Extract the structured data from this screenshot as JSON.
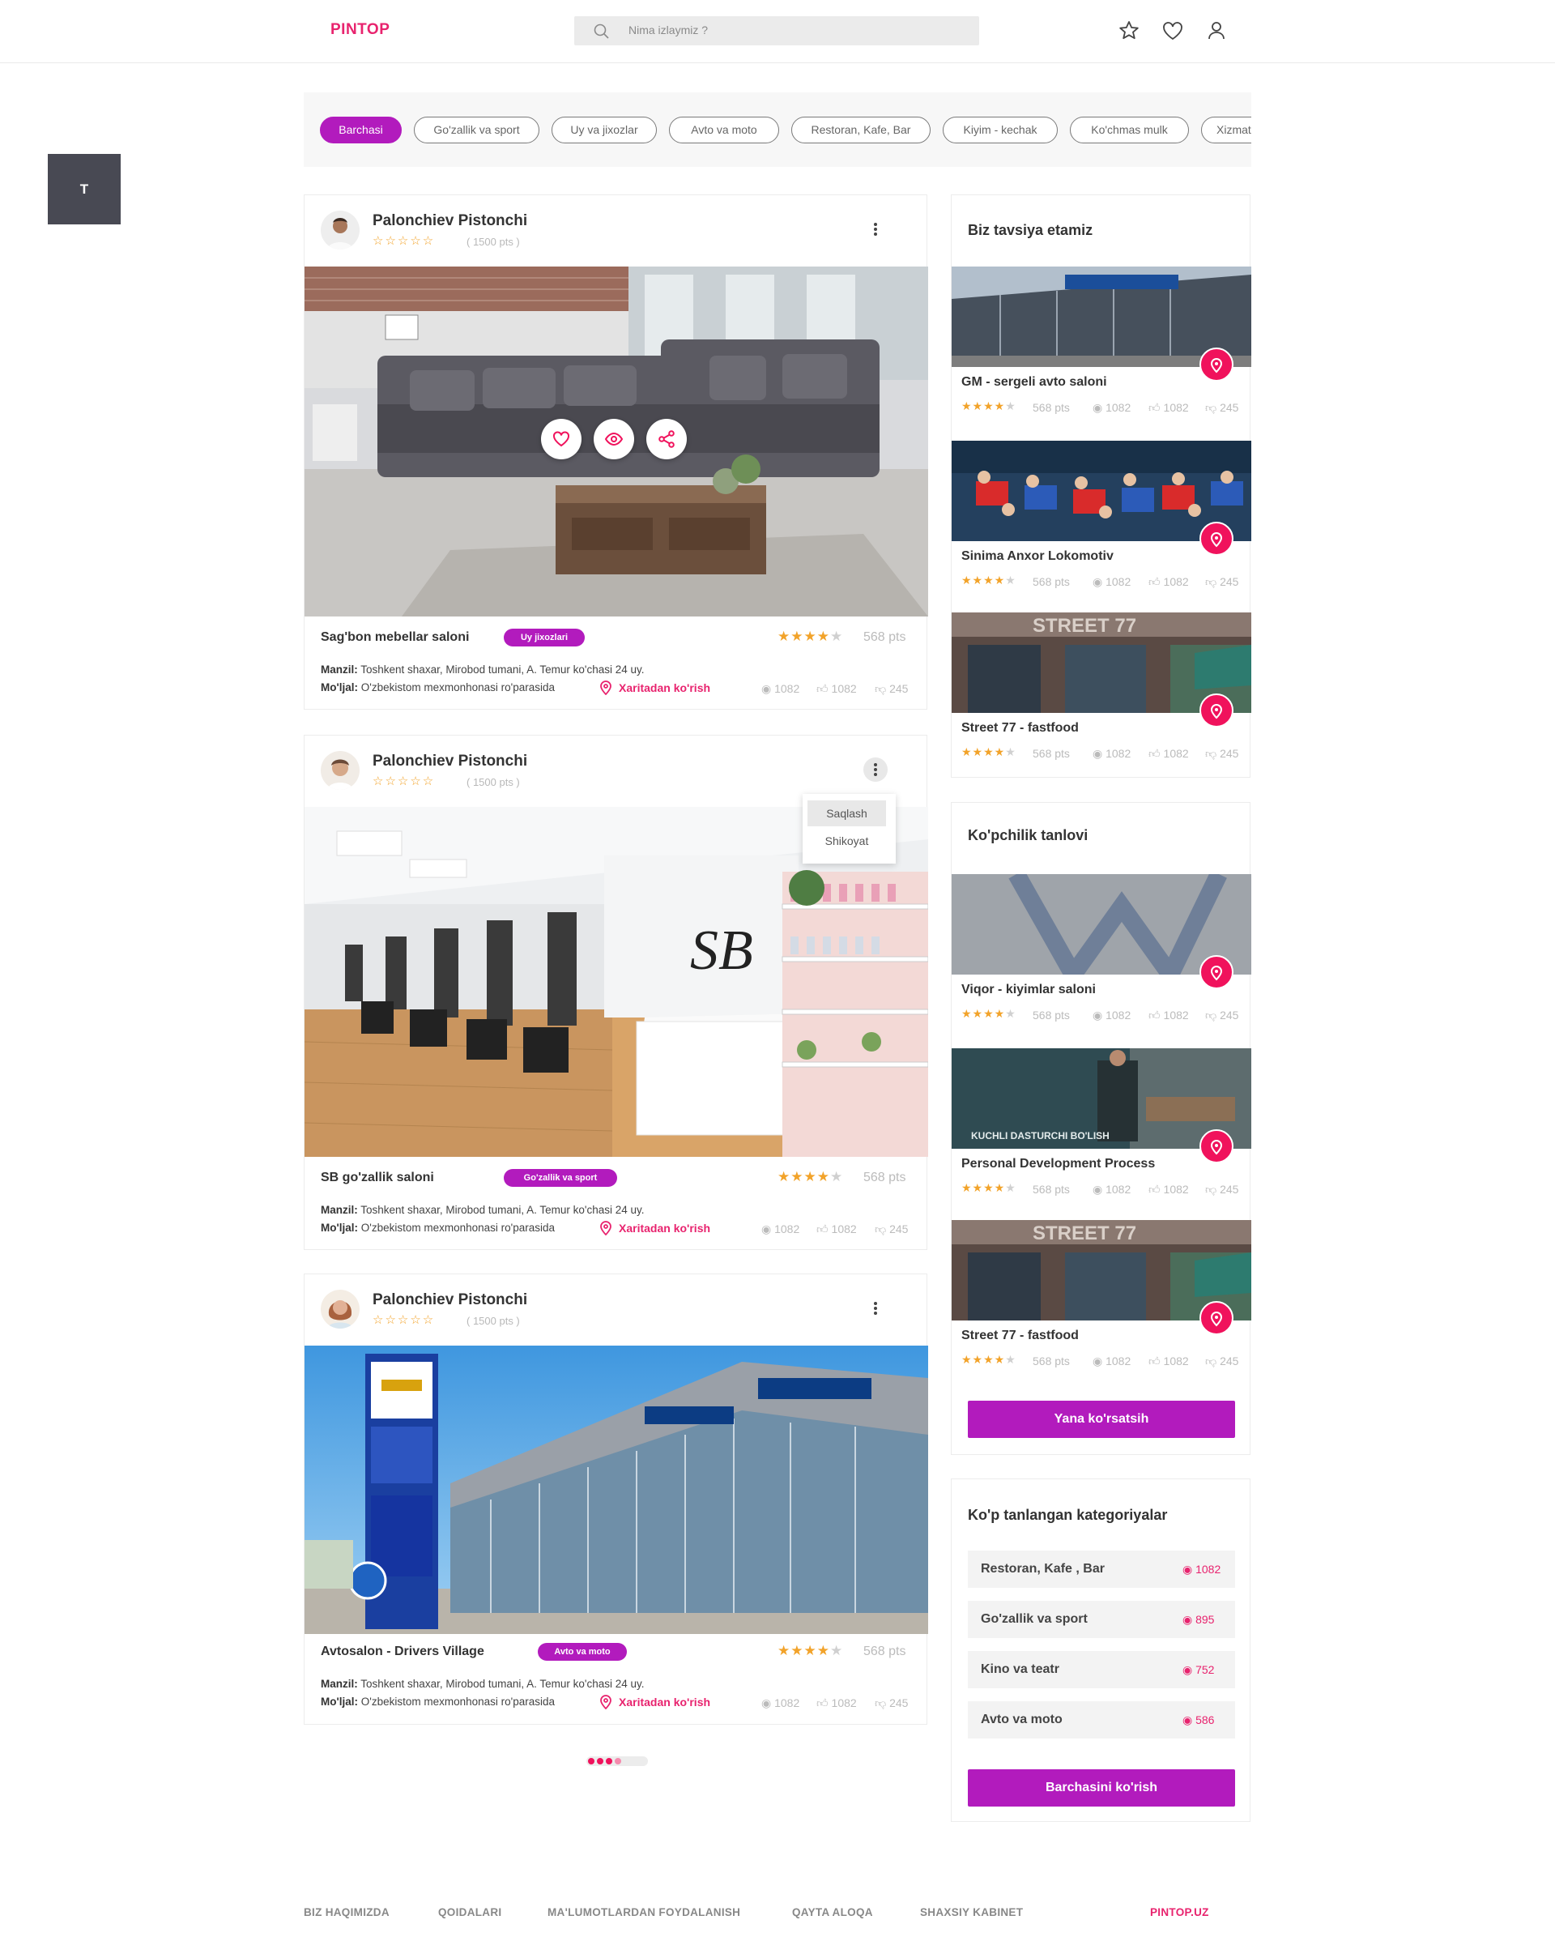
{
  "header": {
    "logo": "PINTOP",
    "search_placeholder": "Nima izlaymiz ?"
  },
  "side_tile": "T",
  "filters": [
    "Barchasi",
    "Go'zallik va sport",
    "Uy va jixozlar",
    "Avto va moto",
    "Restoran, Kafe, Bar",
    "Kiyim - kechak",
    "Ko'chmas mulk",
    "Xizmat"
  ],
  "posts": [
    {
      "user": "Palonchiev Pistonchi",
      "user_pts": "( 1500 pts )",
      "title": "Sag'bon mebellar saloni",
      "tag": "Uy jixozlari",
      "pts": "568 pts",
      "address_label": "Manzil:",
      "address": "Toshkent shaxar, Mirobod tumani, A. Temur ko'chasi 24 uy.",
      "landmark_label": "Mo'ljal:",
      "landmark": "O'zbekistom mexmonhonasi ro'parasida",
      "map_link": "Xaritadan  ko'rish",
      "views": "1082",
      "likes": "1082",
      "dislikes": "245"
    },
    {
      "user": "Palonchiev Pistonchi",
      "user_pts": "( 1500 pts )",
      "title": "SB go'zallik saloni",
      "tag": "Go'zallik va sport",
      "pts": "568 pts",
      "address_label": "Manzil:",
      "address": "Toshkent shaxar, Mirobod tumani, A. Temur ko'chasi 24 uy.",
      "landmark_label": "Mo'ljal:",
      "landmark": "O'zbekistom mexmonhonasi ro'parasida",
      "map_link": "Xaritadan  ko'rish",
      "views": "1082",
      "likes": "1082",
      "dislikes": "245",
      "menu": [
        "Saqlash",
        "Shikoyat"
      ],
      "photo_text": "SB"
    },
    {
      "user": "Palonchiev Pistonchi",
      "user_pts": "( 1500 pts )",
      "title": "Avtosalon - Drivers Village",
      "tag": "Avto va moto",
      "pts": "568 pts",
      "address_label": "Manzil:",
      "address": "Toshkent shaxar, Mirobod tumani, A. Temur ko'chasi 24 uy.",
      "landmark_label": "Mo'ljal:",
      "landmark": "O'zbekistom mexmonhonasi ro'parasida",
      "map_link": "Xaritadan  ko'rish",
      "views": "1082",
      "likes": "1082",
      "dislikes": "245"
    }
  ],
  "recommend": {
    "title": "Biz tavsiya etamiz",
    "items": [
      {
        "name": "GM - sergeli avto saloni",
        "pts": "568 pts",
        "views": "1082",
        "likes": "1082",
        "dislikes": "245"
      },
      {
        "name": "Sinima Anxor Lokomotiv",
        "pts": "568 pts",
        "views": "1082",
        "likes": "1082",
        "dislikes": "245"
      },
      {
        "name": "Street 77 - fastfood",
        "pts": "568 pts",
        "views": "1082",
        "likes": "1082",
        "dislikes": "245",
        "sign": "STREET 77"
      }
    ]
  },
  "popular": {
    "title": "Ko'pchilik tanlovi",
    "button": "Yana ko'rsatsih",
    "items": [
      {
        "name": "Viqor - kiyimlar saloni",
        "pts": "568 pts",
        "views": "1082",
        "likes": "1082",
        "dislikes": "245"
      },
      {
        "name": "Personal Development Process",
        "pts": "568 pts",
        "views": "1082",
        "likes": "1082",
        "dislikes": "245",
        "overlay": "KUCHLI DASTURCHI BO'LISH"
      },
      {
        "name": "Street 77 - fastfood",
        "pts": "568 pts",
        "views": "1082",
        "likes": "1082",
        "dislikes": "245",
        "sign": "STREET 77"
      }
    ]
  },
  "categories": {
    "title": "Ko'p tanlangan kategoriyalar",
    "button": "Barchasini ko'rish",
    "items": [
      {
        "name": "Restoran, Kafe , Bar",
        "count": "1082"
      },
      {
        "name": "Go'zallik va sport",
        "count": "895"
      },
      {
        "name": "Kino va teatr",
        "count": "752"
      },
      {
        "name": "Avto va moto",
        "count": "586"
      }
    ]
  },
  "footer": {
    "links": [
      "BIZ HAQIMIZDA",
      "QOIDALARI",
      "MA'LUMOTLARDAN FOYDALANISH",
      "QAYTA ALOQA",
      "SHAXSIY KABINET"
    ],
    "brand": "PINTOP.UZ"
  },
  "colors": {
    "accent": "#b21bbd",
    "pink": "#e8236e",
    "star": "#f2a32a"
  }
}
